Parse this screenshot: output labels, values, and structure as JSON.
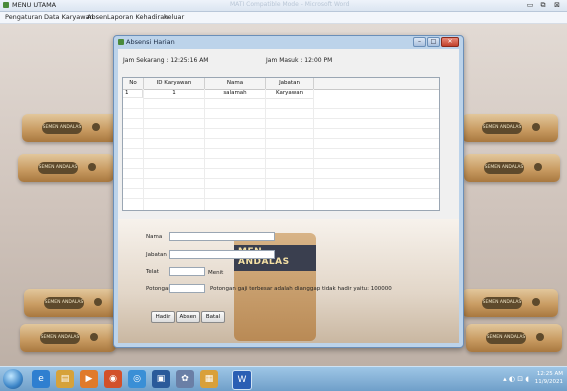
{
  "window": {
    "title": "MENU UTAMA",
    "faint_title": "MATI Compatible Mode - Microsoft Word",
    "buttons": {
      "minimize": "▭",
      "restore": "⧉",
      "close": "⊠"
    }
  },
  "menu": [
    "Pengaturan",
    "Data Karyawan",
    "Absen",
    "Laporan Kehadiran",
    "keluar"
  ],
  "child": {
    "title": "Absensi Harian",
    "jam_sekarang": "Jam Sekarang : 12:25:16 AM",
    "jam_masuk": "Jam Masuk : 12:00 PM",
    "grid": {
      "columns": [
        "No",
        "ID Karyawan",
        "Nama",
        "Jabatan"
      ],
      "rows": [
        [
          "1",
          "1",
          "salamah",
          "Karyawan"
        ]
      ]
    },
    "form": {
      "nama_label": "Nama",
      "jabatan_label": "Jabatan",
      "telat_label": "Telat",
      "menit_label": "Menit",
      "potongan_label": "Potongan",
      "potongan_note": "Potongan gaji terbesar adalah dianggap tidak hadir yaitu: 100000",
      "nama_value": "",
      "jabatan_value": "",
      "telat_value": "",
      "potongan_value": ""
    },
    "buttons": {
      "hadir": "Hadir",
      "absen": "Absen",
      "batal": "Batal"
    },
    "bag_text": "MEN ANDALAS"
  },
  "taskbar": {
    "time": "12:25 AM",
    "date": "11/9/2021",
    "tray_icons": "▴ ◐ ⊡ ◖"
  },
  "sack_label": "SEMEN ANDALAS"
}
